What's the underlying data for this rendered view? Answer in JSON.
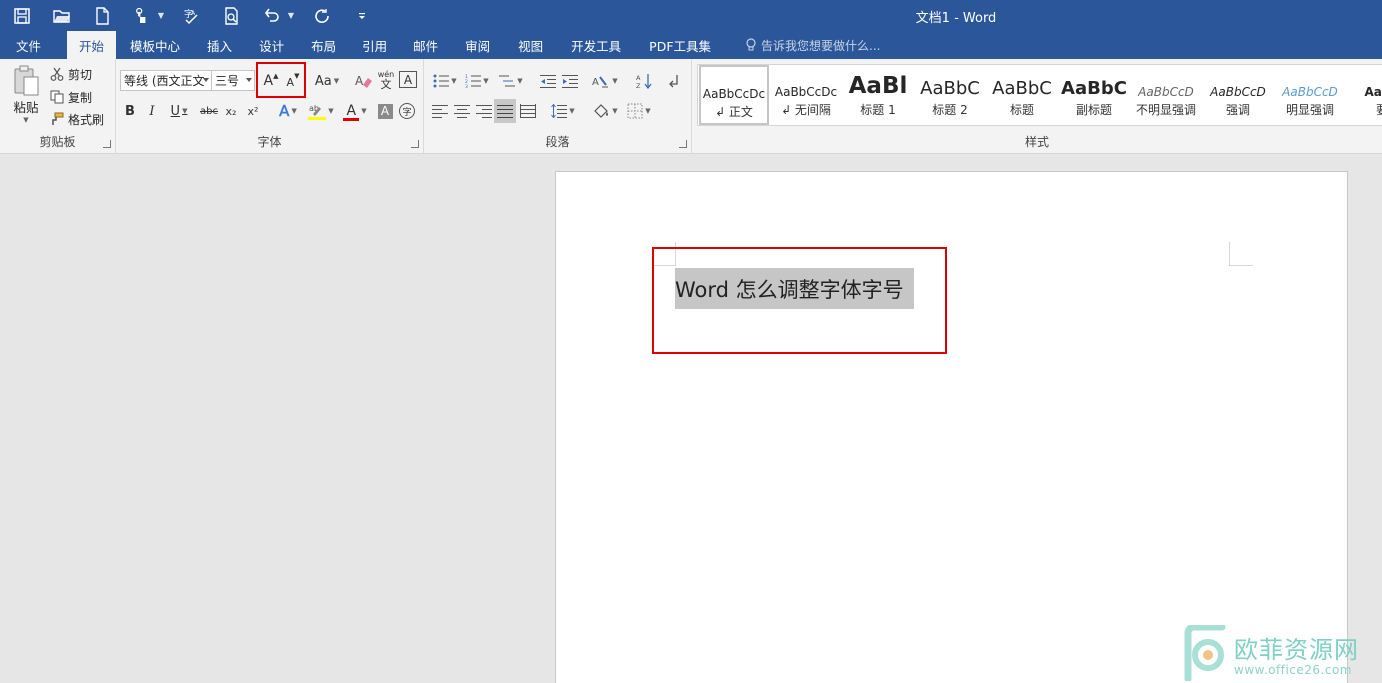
{
  "window": {
    "title": "文档1 - Word"
  },
  "quick_access": {
    "icons": [
      "save-icon",
      "open-folder-icon",
      "new-document-icon",
      "touch-mode-icon",
      "spelling-icon",
      "print-preview-icon",
      "undo-icon",
      "redo-icon",
      "customize-icon"
    ]
  },
  "tabs": [
    {
      "label": "文件"
    },
    {
      "label": "开始",
      "active": true
    },
    {
      "label": "模板中心"
    },
    {
      "label": "插入"
    },
    {
      "label": "设计"
    },
    {
      "label": "布局"
    },
    {
      "label": "引用"
    },
    {
      "label": "邮件"
    },
    {
      "label": "审阅"
    },
    {
      "label": "视图"
    },
    {
      "label": "开发工具"
    },
    {
      "label": "PDF工具集"
    }
  ],
  "tell_me": {
    "placeholder": "告诉我您想要做什么..."
  },
  "clipboard": {
    "paste": "粘贴",
    "cut": "剪切",
    "copy": "复制",
    "format_painter": "格式刷",
    "group_label": "剪贴板"
  },
  "font": {
    "font_name": "等线 (西文正文",
    "font_size": "三号",
    "grow_label": "A",
    "shrink_label": "A",
    "change_case": "Aa",
    "phonetic": "wén",
    "bold": "B",
    "italic": "I",
    "underline": "U",
    "strikethrough": "abc",
    "subscript": "x₂",
    "superscript": "x²",
    "text_effects": "A",
    "font_color": "A",
    "char_shading": "A",
    "enclose": "字",
    "group_label": "字体"
  },
  "paragraph": {
    "group_label": "段落"
  },
  "styles": {
    "group_label": "样式",
    "items": [
      {
        "sample": "AaBbCcDc",
        "name": "↲ 正文"
      },
      {
        "sample": "AaBbCcDc",
        "name": "↲ 无间隔"
      },
      {
        "sample": "AaBl",
        "name": "标题 1"
      },
      {
        "sample": "AaBbC",
        "name": "标题 2"
      },
      {
        "sample": "AaBbC",
        "name": "标题"
      },
      {
        "sample": "AaBbC",
        "name": "副标题"
      },
      {
        "sample": "AaBbCcD",
        "name": "不明显强调"
      },
      {
        "sample": "AaBbCcD",
        "name": "强调"
      },
      {
        "sample": "AaBbCcD",
        "name": "明显强调"
      },
      {
        "sample": "AaBb",
        "name": "要"
      }
    ]
  },
  "document": {
    "text": "Word 怎么调整字体字号"
  },
  "colors": {
    "brand": "#2b579a",
    "highlight_border": "#e00000",
    "font_color_bar": "#e00000",
    "highlight_bar": "#ffff00"
  },
  "watermark": {
    "title": "欧菲资源网",
    "url": "www.office26.com"
  }
}
